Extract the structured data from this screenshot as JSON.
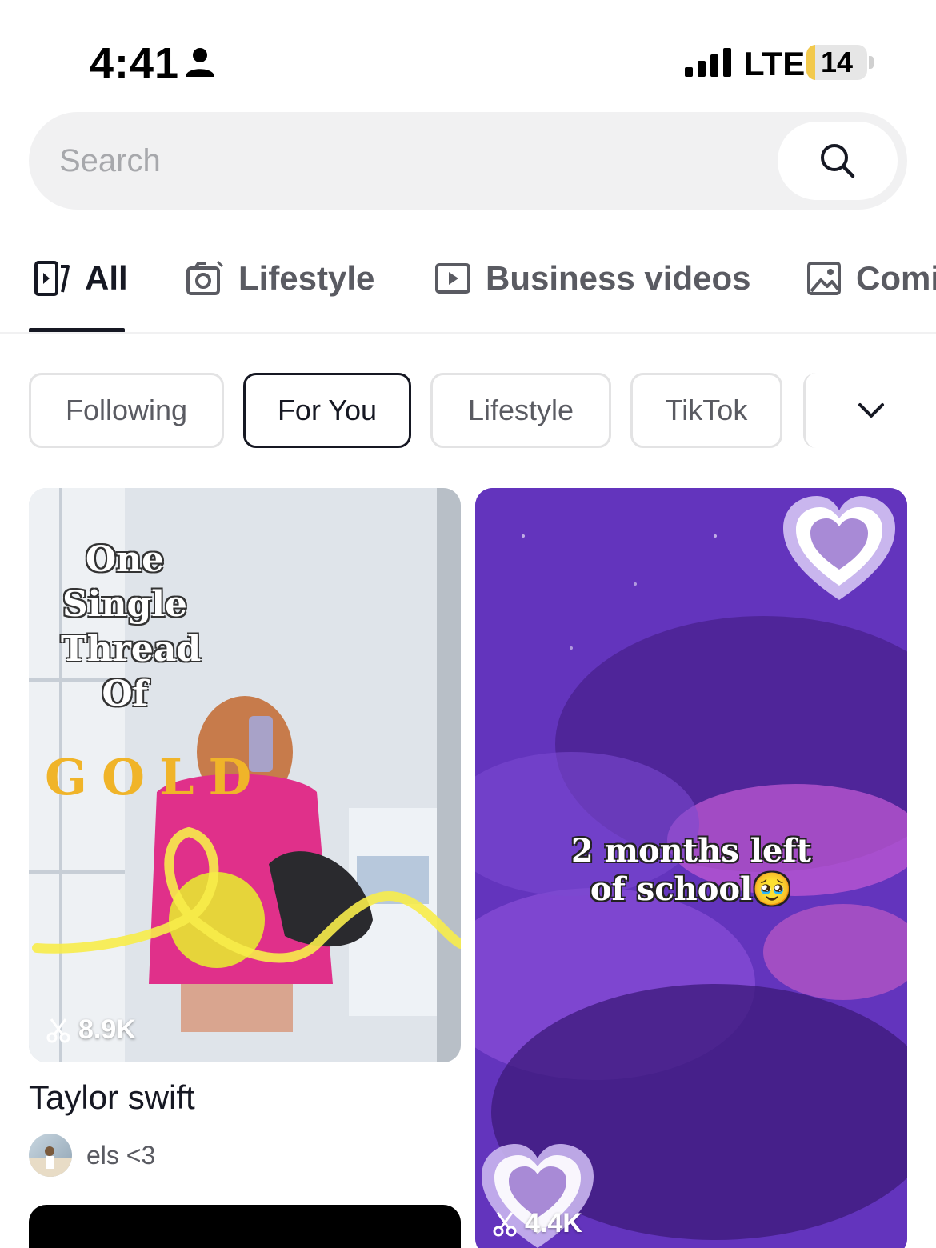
{
  "status_bar": {
    "time": "4:41",
    "network": "LTE",
    "battery_level": "14",
    "battery_fraction": 0.14,
    "battery_color": "#f2c94c"
  },
  "search": {
    "placeholder": "Search",
    "value": ""
  },
  "tabs": [
    {
      "label": "All",
      "icon": "video-frame-icon"
    },
    {
      "label": "Lifestyle",
      "icon": "camera-icon"
    },
    {
      "label": "Business videos",
      "icon": "play-rectangle-icon"
    },
    {
      "label": "Comi",
      "icon": "image-icon"
    }
  ],
  "chips": [
    "Following",
    "For You",
    "Lifestyle",
    "TikTok"
  ],
  "cards": [
    {
      "overlay_lines": [
        "One",
        "Single",
        "Thread",
        "Of"
      ],
      "overlay_gold": "GOLD",
      "count": "8.9K",
      "title": "Taylor swift",
      "author": "els <3"
    },
    {
      "overlay_lines": [
        "2 months left",
        "of school🥹"
      ],
      "count": "4.4K"
    }
  ],
  "colors": {
    "accent_text": "#161823",
    "muted_text": "#5a5b62",
    "card_purple": "#6a38c6"
  }
}
